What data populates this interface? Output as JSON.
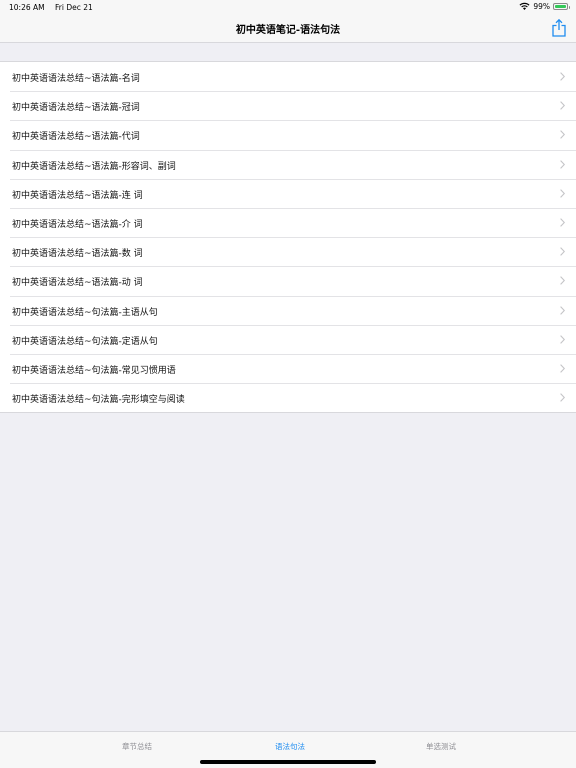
{
  "status": {
    "time": "10:26 AM",
    "date": "Fri Dec 21",
    "battery_percent": "99%",
    "battery_level": 0.99
  },
  "nav": {
    "title": "初中英语笔记-语法句法",
    "share_icon": "share-icon"
  },
  "list": {
    "items": [
      "初中英语语法总结~语法篇-名词",
      "初中英语语法总结~语法篇-冠词",
      "初中英语语法总结~语法篇-代词",
      "初中英语语法总结~语法篇-形容词、副词",
      "初中英语语法总结~语法篇-连 词",
      "初中英语语法总结~语法篇-介 词",
      "初中英语语法总结~语法篇-数 词",
      "初中英语语法总结~语法篇-动 词",
      "初中英语语法总结~句法篇-主语从句",
      "初中英语语法总结~句法篇-定语从句",
      "初中英语语法总结~句法篇-常见习惯用语",
      "初中英语语法总结~句法篇-完形填空与阅读"
    ]
  },
  "tabs": [
    {
      "label": "章节总结",
      "active": false
    },
    {
      "label": "语法句法",
      "active": true
    },
    {
      "label": "单选测试",
      "active": false
    }
  ],
  "colors": {
    "accent": "#1e8cf0",
    "inactive_tab": "#8e8e93",
    "background": "#efeff4",
    "battery": "#34c759"
  }
}
